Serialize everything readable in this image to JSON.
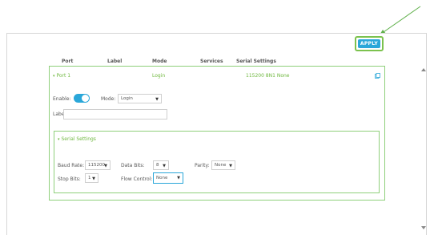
{
  "toolbar": {
    "apply_label": "APPLY"
  },
  "columns": [
    "Port",
    "Label",
    "Mode",
    "Services",
    "Serial Settings"
  ],
  "port_row": {
    "port": "Port 1",
    "mode": "Login",
    "serial": "115200 8N1 None"
  },
  "form": {
    "enable_label": "Enable:",
    "mode_label": "Mode:",
    "mode_value": "Login",
    "label_label": "Label:",
    "label_value": ""
  },
  "serial": {
    "title": "Serial Settings",
    "baud_label": "Baud Rate:",
    "baud_value": "115200",
    "databits_label": "Data Bits:",
    "databits_value": "8",
    "parity_label": "Parity:",
    "parity_value": "None",
    "stopbits_label": "Stop Bits:",
    "stopbits_value": "1",
    "flow_label": "Flow Control:",
    "flow_value": "None"
  },
  "colors": {
    "accent": "#2aa7d9",
    "green": "#7cc24e",
    "green_text": "#6fb83f"
  }
}
